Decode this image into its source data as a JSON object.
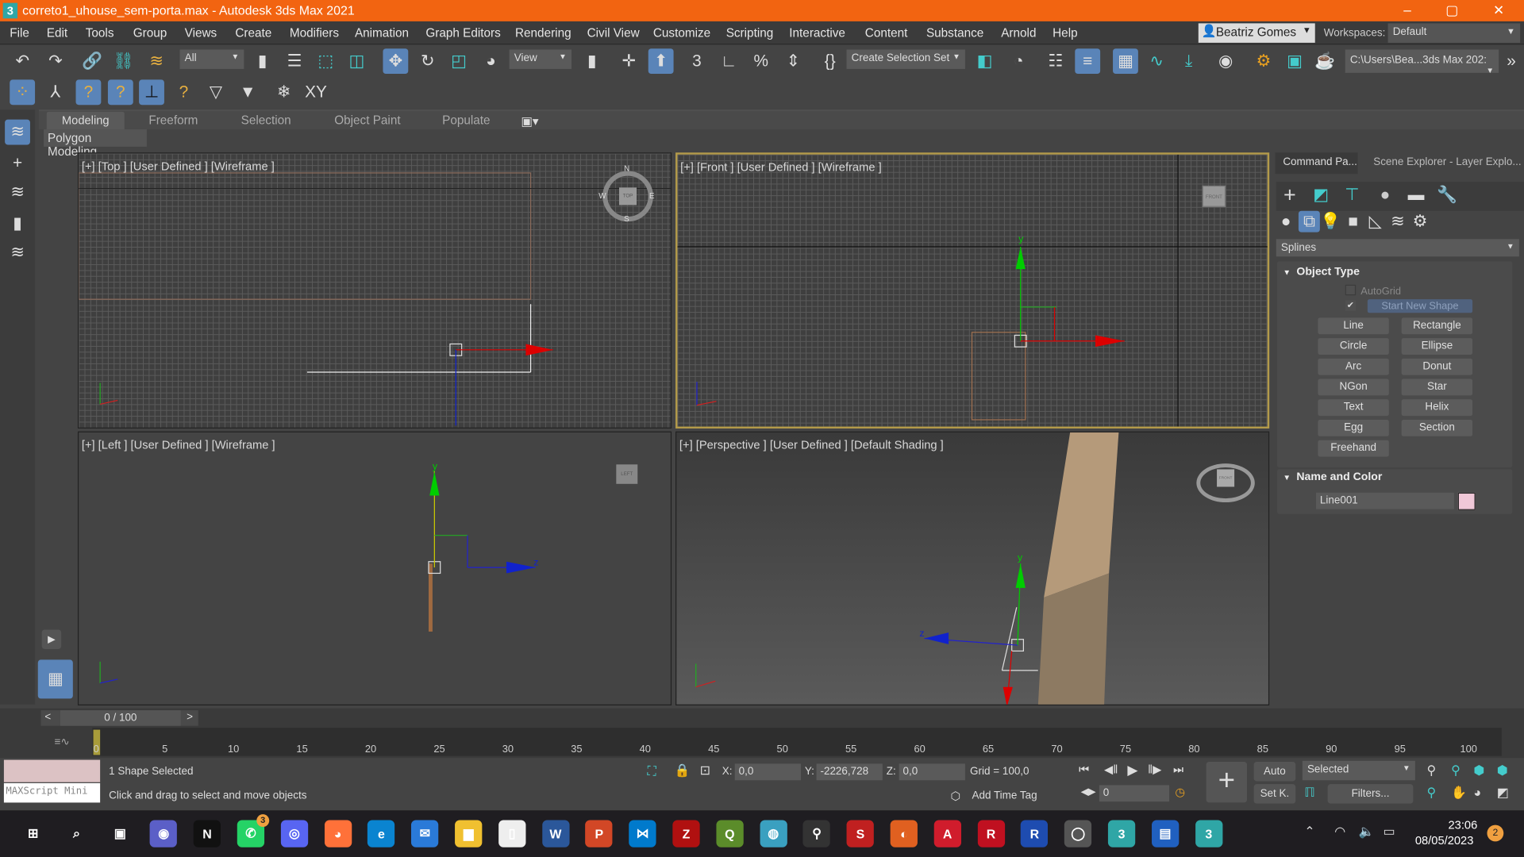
{
  "window": {
    "title": "correto1_uhouse_sem-porta.max - Autodesk 3ds Max 2021",
    "app_logo": "3",
    "minimize": "–",
    "maximize": "▢",
    "close": "✕"
  },
  "menu": [
    "File",
    "Edit",
    "Tools",
    "Group",
    "Views",
    "Create",
    "Modifiers",
    "Animation",
    "Graph Editors",
    "Rendering",
    "Civil View",
    "Customize",
    "Scripting",
    "Interactive",
    "Content",
    "Substance",
    "Arnold",
    "Help"
  ],
  "user": {
    "name": "Beatriz Gomes",
    "workspaces_label": "Workspaces:",
    "workspace": "Default"
  },
  "toolbar": {
    "selection_filter": "All",
    "ref_coord": "View",
    "selection_set": "Create Selection Set",
    "project_path": "C:\\Users\\Bea...3ds Max 202:"
  },
  "ribbon": {
    "tabs": [
      "Modeling",
      "Freeform",
      "Selection",
      "Object Paint",
      "Populate"
    ],
    "active": "Modeling",
    "panel": "Polygon Modeling"
  },
  "viewports": {
    "top": {
      "label": "[+] [Top ] [User Defined ] [Wireframe ]",
      "compass": [
        "N",
        "S",
        "E",
        "W"
      ],
      "cube": "TOP"
    },
    "front": {
      "label": "[+] [Front ] [User Defined ] [Wireframe ]",
      "cube": "FRONT",
      "active": true
    },
    "left": {
      "label": "[+] [Left ] [User Defined ] [Wireframe ]",
      "cube": "LEFT"
    },
    "perspective": {
      "label": "[+] [Perspective ] [User Defined ] [Default Shading ]",
      "cube": "FRONT"
    },
    "axes": {
      "x": "x",
      "y": "y",
      "z": "z"
    }
  },
  "command_panel": {
    "tabs": [
      "Command Pa...",
      "Scene Explorer - Layer Explo..."
    ],
    "category": "Splines",
    "object_type": {
      "title": "Object Type",
      "autogrid": "AutoGrid",
      "autogrid_checked": false,
      "start_new_shape": "Start New Shape",
      "start_new_shape_checked": true,
      "buttons": [
        "Line",
        "Rectangle",
        "Circle",
        "Ellipse",
        "Arc",
        "Donut",
        "NGon",
        "Star",
        "Text",
        "Helix",
        "Egg",
        "Section",
        "Freehand"
      ]
    },
    "name_color": {
      "title": "Name and Color",
      "name": "Line001",
      "color": "#f0c8d8"
    }
  },
  "timeline": {
    "frame": "0 / 100",
    "prev": "<",
    "next": ">",
    "ticks": [
      "0",
      "5",
      "10",
      "15",
      "20",
      "25",
      "30",
      "35",
      "40",
      "45",
      "50",
      "55",
      "60",
      "65",
      "70",
      "75",
      "80",
      "85",
      "90",
      "95",
      "100"
    ]
  },
  "status": {
    "maxscript": "MAXScript Mini",
    "selection": "1 Shape Selected",
    "prompt": "Click and drag to select and move objects",
    "x_label": "X:",
    "x": "0,0",
    "y_label": "Y:",
    "y": "-2226,728",
    "z_label": "Z:",
    "z": "0,0",
    "grid": "Grid = 100,0",
    "add_time_tag": "Add Time Tag",
    "frame_field": "0",
    "auto": "Auto",
    "set_key": "Set K.",
    "key_filter": "Selected",
    "filters": "Filters..."
  },
  "taskbar": {
    "apps": [
      "Start",
      "Search",
      "Task View",
      "Teams",
      "Netflix",
      "WhatsApp",
      "Discord",
      "Firefox",
      "Edge",
      "Mail",
      "File Explorer",
      "Notepad",
      "Word",
      "PowerPoint",
      "VS Code",
      "FileZilla",
      "QGIS",
      "Browser",
      "App",
      "SketchUp",
      "Grapher",
      "AutoCAD",
      "Revit",
      "Revit Viewer",
      "Browser2",
      "3ds Max",
      "Notes",
      "3ds Max 2021"
    ],
    "whatsapp_badge": "3",
    "time": "23:06",
    "date": "08/05/2023",
    "notifications": "2"
  }
}
